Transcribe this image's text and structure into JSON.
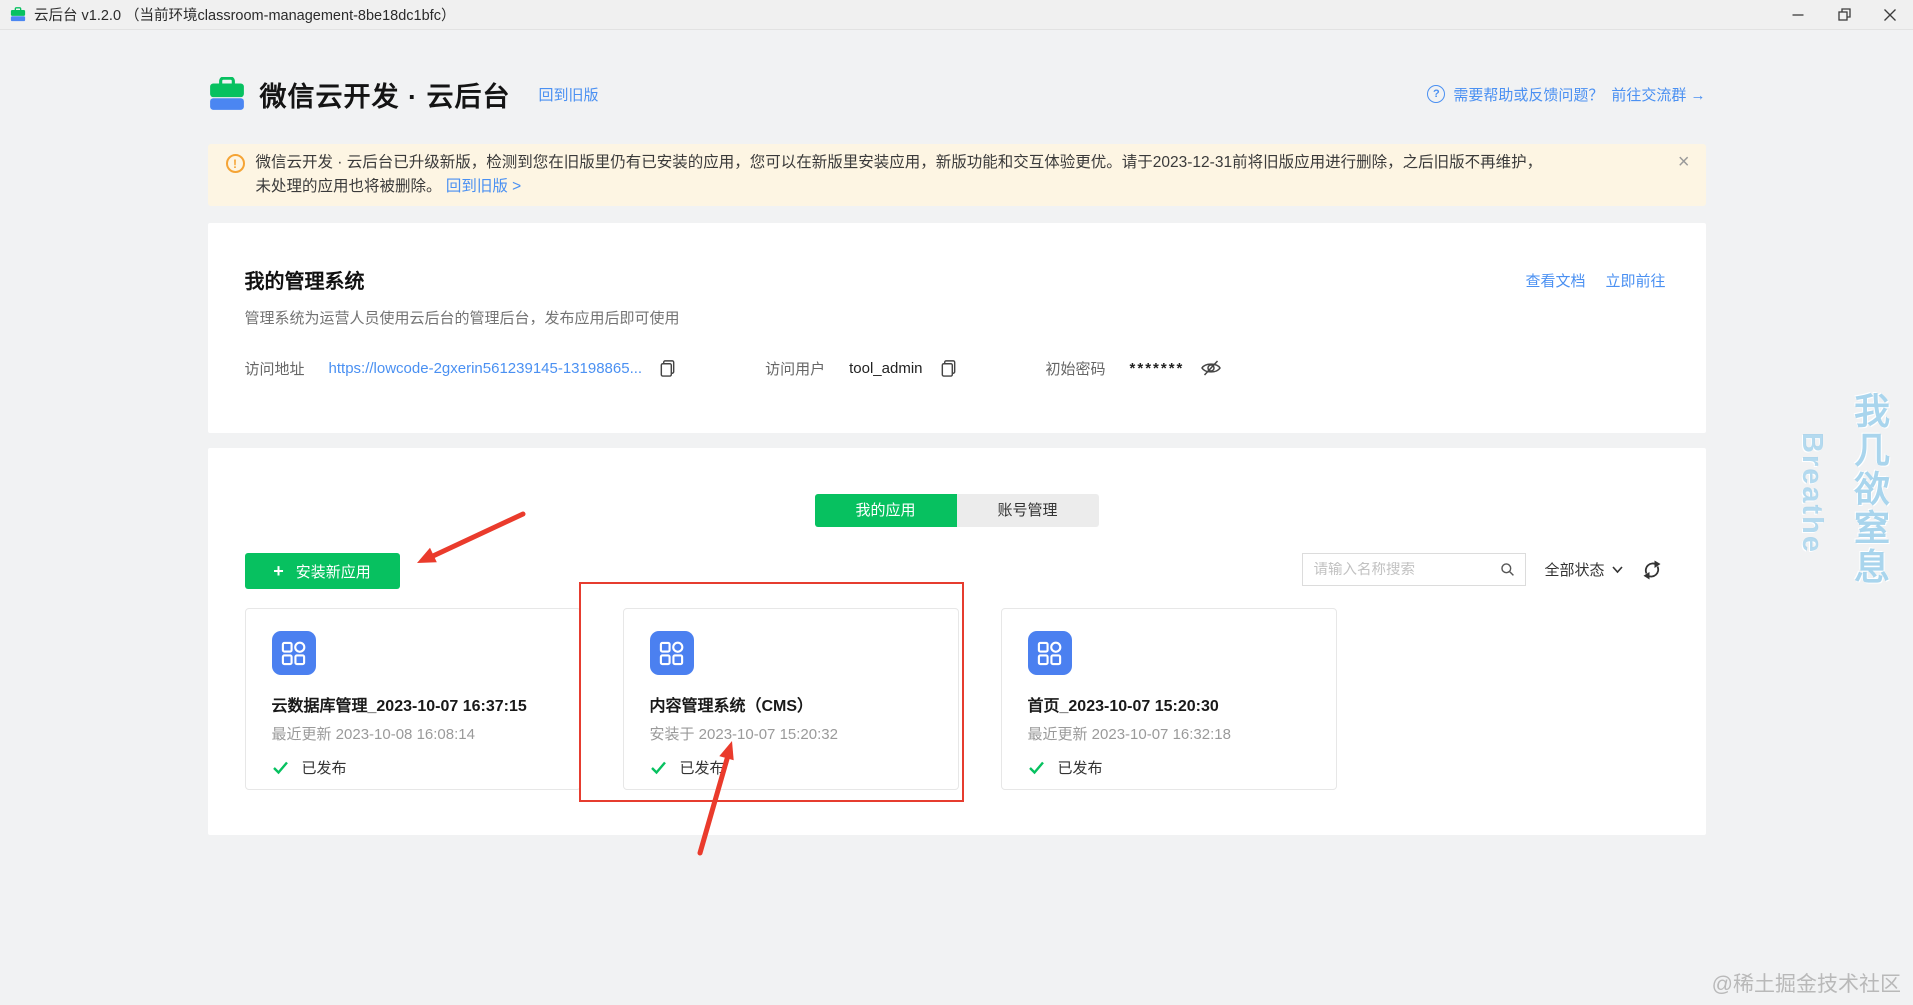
{
  "titlebar": {
    "title": "云后台 v1.2.0 （当前环境classroom-management-8be18dc1bfc）"
  },
  "header": {
    "title": "微信云开发 · 云后台",
    "back_link": "回到旧版",
    "help_icon": "?",
    "help_text": "需要帮助或反馈问题？",
    "group_link": "前往交流群 →"
  },
  "banner": {
    "icon": "!",
    "line1": "微信云开发 · 云后台已升级新版，检测到您在旧版里仍有已安装的应用，您可以在新版里安装应用，新版功能和交互体验更优。请于2023-12-31前将旧版应用进行删除，之后旧版不再维护，",
    "line2": "未处理的应用也将被删除。",
    "line2_link": "回到旧版 >",
    "close_icon": "×"
  },
  "system_panel": {
    "title": "我的管理系统",
    "doc_link": "查看文档",
    "go_link": "立即前往",
    "subtitle": "管理系统为运营人员使用云后台的管理后台，发布应用后即可使用",
    "address_label": "访问地址",
    "address_value": "https://lowcode-2gxerin561239145-13198865...",
    "user_label": "访问用户",
    "user_value": "tool_admin",
    "password_label": "初始密码",
    "password_value": "*******"
  },
  "apps_panel": {
    "tabs": [
      {
        "label": "我的应用"
      },
      {
        "label": "账号管理"
      }
    ],
    "install_plus": "+",
    "install_label": "安装新应用",
    "search_placeholder": "请输入名称搜索",
    "status_filter": "全部状态",
    "cards": [
      {
        "title": "云数据库管理_2023-10-07 16:37:15",
        "meta": "最近更新 2023-10-08 16:08:14",
        "status": "已发布"
      },
      {
        "title": "内容管理系统（CMS）",
        "meta": "安装于 2023-10-07 15:20:32",
        "status": "已发布"
      },
      {
        "title": "首页_2023-10-07 15:20:30",
        "meta": "最近更新 2023-10-07 16:32:18",
        "status": "已发布"
      }
    ]
  },
  "watermark": {
    "en": "Breathe",
    "cn": "我几欲窒息",
    "credit": "@稀土掘金技术社区"
  },
  "colors": {
    "brand_green": "#07c160",
    "link_blue": "#4a90f2",
    "app_icon_blue": "#4b80f0",
    "annotation_red": "#ea3b2c",
    "banner_bg": "#fdf5e3",
    "warning_orange": "#f5a435"
  }
}
